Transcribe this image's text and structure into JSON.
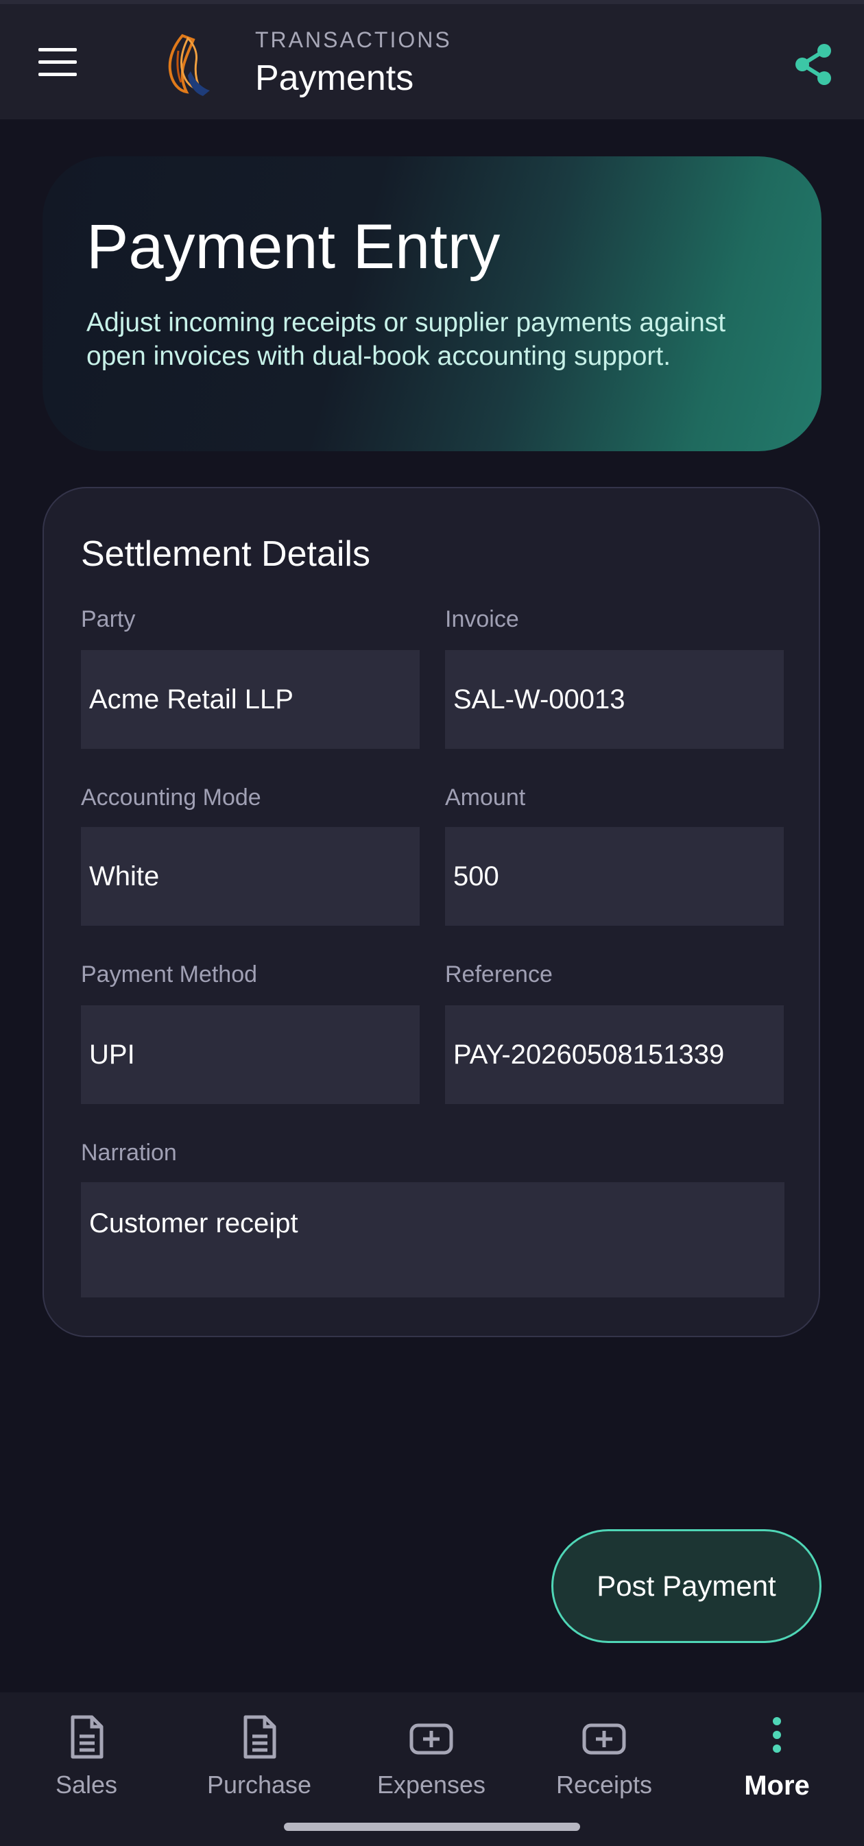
{
  "appbar": {
    "kicker": "TRANSACTIONS",
    "title": "Payments"
  },
  "hero": {
    "title": "Payment Entry",
    "subtitle": "Adjust incoming receipts or supplier payments against open invoices with dual-book accounting support."
  },
  "card": {
    "title": "Settlement Details",
    "fields": {
      "party": {
        "label": "Party",
        "value": "Acme Retail LLP"
      },
      "invoice": {
        "label": "Invoice",
        "value": "SAL-W-00013"
      },
      "mode": {
        "label": "Accounting Mode",
        "value": "White"
      },
      "amount": {
        "label": "Amount",
        "value": "500"
      },
      "method": {
        "label": "Payment Method",
        "value": "UPI"
      },
      "reference": {
        "label": "Reference",
        "value": "PAY-20260508151339"
      },
      "narration": {
        "label": "Narration",
        "value": "Customer receipt"
      }
    }
  },
  "actions": {
    "post_label": "Post Payment"
  },
  "bottom_nav": {
    "items": [
      {
        "label": "Sales",
        "icon": "document-icon"
      },
      {
        "label": "Purchase",
        "icon": "document-icon"
      },
      {
        "label": "Expenses",
        "icon": "add-box-icon"
      },
      {
        "label": "Receipts",
        "icon": "add-box-icon"
      },
      {
        "label": "More",
        "icon": "more-vertical-icon"
      }
    ],
    "active": "More"
  },
  "colors": {
    "accent": "#4fd6b6",
    "background": "#13131f",
    "surface": "#1e1e2c",
    "field": "#2c2c3c"
  }
}
